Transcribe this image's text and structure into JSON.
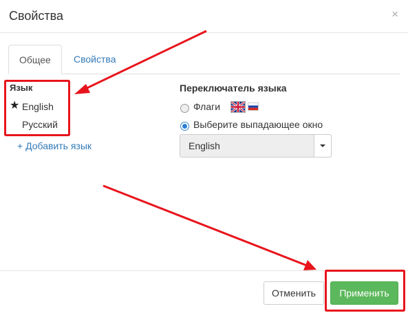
{
  "dialog": {
    "title": "Свойства",
    "close_icon": "×"
  },
  "tabs": [
    {
      "label": "Общее",
      "active": true
    },
    {
      "label": "Свойства",
      "active": false
    }
  ],
  "languages": {
    "label": "Язык",
    "items": [
      {
        "name": "English",
        "default": true
      },
      {
        "name": "Русский",
        "default": false
      }
    ],
    "add_label": "+ Добавить язык"
  },
  "switcher": {
    "title": "Переключатель языка",
    "options": [
      {
        "label": "Флаги",
        "checked": false
      },
      {
        "label": "Выберите выпадающее окно",
        "checked": true
      }
    ],
    "dropdown_value": "English"
  },
  "footer": {
    "cancel_label": "Отменить",
    "apply_label": "Применить"
  },
  "colors": {
    "annotation": "#e8141c",
    "apply": "#5cb85c",
    "link": "#337ab7"
  }
}
